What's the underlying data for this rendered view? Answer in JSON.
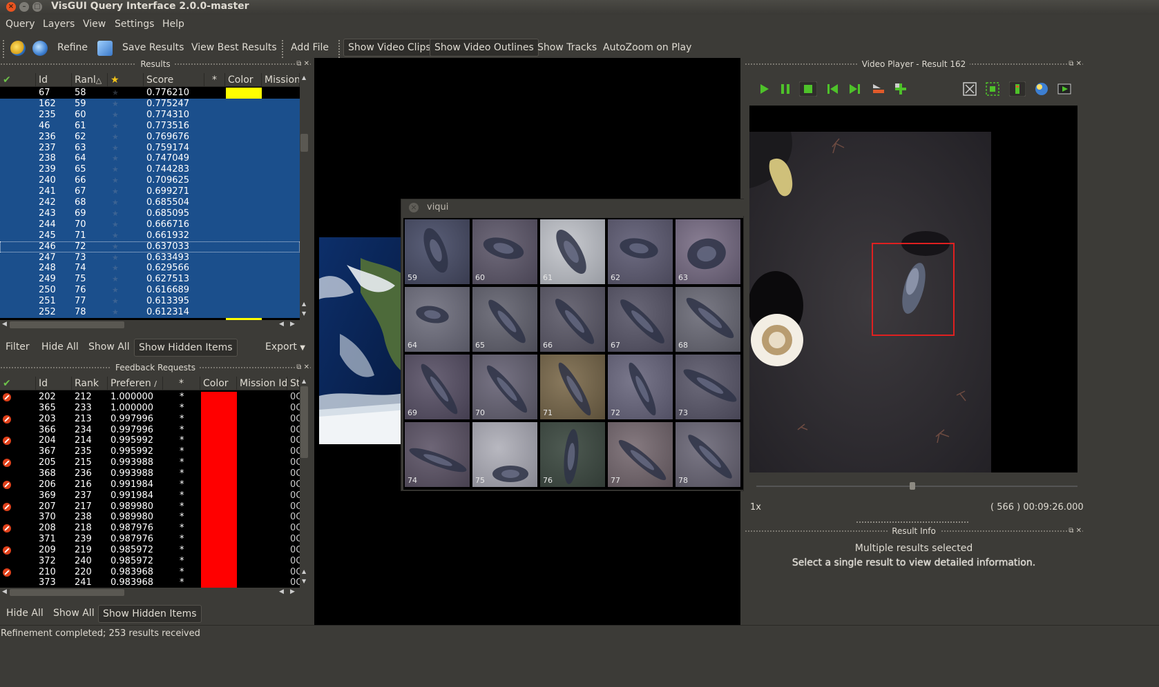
{
  "window": {
    "title": "VisGUI Query Interface 2.0.0-master"
  },
  "menu": [
    "Query",
    "Layers",
    "View",
    "Settings",
    "Help"
  ],
  "toolbar": {
    "refine": "Refine",
    "save_results": "Save Results",
    "view_best": "View Best Results",
    "add_file": "Add File",
    "show_clips": "Show Video Clips",
    "show_outlines": "Show Video Outlines",
    "show_tracks": "Show Tracks",
    "autozoom": "AutoZoom on Play"
  },
  "results": {
    "title": "Results",
    "headers": {
      "check": "✔",
      "id": "Id",
      "rank": "Ranl",
      "star": "★",
      "score": "Score",
      "ast": "*",
      "color": "Color",
      "mission": "Mission"
    },
    "rows": [
      {
        "id": "67",
        "rank": "58",
        "score": "0.776210",
        "color": "#ffff00"
      },
      {
        "id": "162",
        "rank": "59",
        "score": "0.775247"
      },
      {
        "id": "235",
        "rank": "60",
        "score": "0.774310"
      },
      {
        "id": "46",
        "rank": "61",
        "score": "0.773516"
      },
      {
        "id": "236",
        "rank": "62",
        "score": "0.769676"
      },
      {
        "id": "237",
        "rank": "63",
        "score": "0.759174"
      },
      {
        "id": "238",
        "rank": "64",
        "score": "0.747049"
      },
      {
        "id": "239",
        "rank": "65",
        "score": "0.744283"
      },
      {
        "id": "240",
        "rank": "66",
        "score": "0.709625"
      },
      {
        "id": "241",
        "rank": "67",
        "score": "0.699271"
      },
      {
        "id": "242",
        "rank": "68",
        "score": "0.685504"
      },
      {
        "id": "243",
        "rank": "69",
        "score": "0.685095"
      },
      {
        "id": "244",
        "rank": "70",
        "score": "0.666716"
      },
      {
        "id": "245",
        "rank": "71",
        "score": "0.661932"
      },
      {
        "id": "246",
        "rank": "72",
        "score": "0.637033"
      },
      {
        "id": "247",
        "rank": "73",
        "score": "0.633493"
      },
      {
        "id": "248",
        "rank": "74",
        "score": "0.629566"
      },
      {
        "id": "249",
        "rank": "75",
        "score": "0.627513"
      },
      {
        "id": "250",
        "rank": "76",
        "score": "0.616689"
      },
      {
        "id": "251",
        "rank": "77",
        "score": "0.613395"
      },
      {
        "id": "252",
        "rank": "78",
        "score": "0.612314"
      }
    ],
    "filter": "Filter",
    "hide_all": "Hide All",
    "show_all": "Show All",
    "show_hidden": "Show Hidden Items",
    "export": "Export"
  },
  "feedback": {
    "title": "Feedback Requests",
    "headers": {
      "check": "✔",
      "id": "Id",
      "rank": "Rank",
      "pref": "Preferen",
      "ast": "*",
      "color": "Color",
      "mission": "Mission Id",
      "st": "St"
    },
    "rows": [
      {
        "id": "202",
        "rank": "212",
        "pref": "1.000000",
        "icon": true
      },
      {
        "id": "365",
        "rank": "233",
        "pref": "1.000000"
      },
      {
        "id": "203",
        "rank": "213",
        "pref": "0.997996",
        "icon": true
      },
      {
        "id": "366",
        "rank": "234",
        "pref": "0.997996"
      },
      {
        "id": "204",
        "rank": "214",
        "pref": "0.995992",
        "icon": true
      },
      {
        "id": "367",
        "rank": "235",
        "pref": "0.995992"
      },
      {
        "id": "205",
        "rank": "215",
        "pref": "0.993988",
        "icon": true
      },
      {
        "id": "368",
        "rank": "236",
        "pref": "0.993988"
      },
      {
        "id": "206",
        "rank": "216",
        "pref": "0.991984",
        "icon": true
      },
      {
        "id": "369",
        "rank": "237",
        "pref": "0.991984"
      },
      {
        "id": "207",
        "rank": "217",
        "pref": "0.989980",
        "icon": true
      },
      {
        "id": "370",
        "rank": "238",
        "pref": "0.989980"
      },
      {
        "id": "208",
        "rank": "218",
        "pref": "0.987976",
        "icon": true
      },
      {
        "id": "371",
        "rank": "239",
        "pref": "0.987976"
      },
      {
        "id": "209",
        "rank": "219",
        "pref": "0.985972",
        "icon": true
      },
      {
        "id": "372",
        "rank": "240",
        "pref": "0.985972"
      },
      {
        "id": "210",
        "rank": "220",
        "pref": "0.983968",
        "icon": true
      },
      {
        "id": "373",
        "rank": "241",
        "pref": "0.983968"
      }
    ],
    "ast": "*",
    "st": "0C",
    "color": "#ff0000",
    "hide_all": "Hide All",
    "show_all": "Show All",
    "show_hidden": "Show Hidden Items"
  },
  "viqui": {
    "title": "viqui",
    "thumbs": [
      "59",
      "60",
      "61",
      "62",
      "63",
      "64",
      "65",
      "66",
      "67",
      "68",
      "69",
      "70",
      "71",
      "72",
      "73",
      "74",
      "75",
      "76",
      "77",
      "78"
    ]
  },
  "video_player": {
    "title": "Video Player - Result 162",
    "speed": "1x",
    "time": "( 566 ) 00:09:26.000"
  },
  "result_info": {
    "title": "Result Info",
    "line1": "Multiple results selected",
    "line2": "Select a single result to view detailed information."
  },
  "status": "Refinement completed; 253 results received"
}
